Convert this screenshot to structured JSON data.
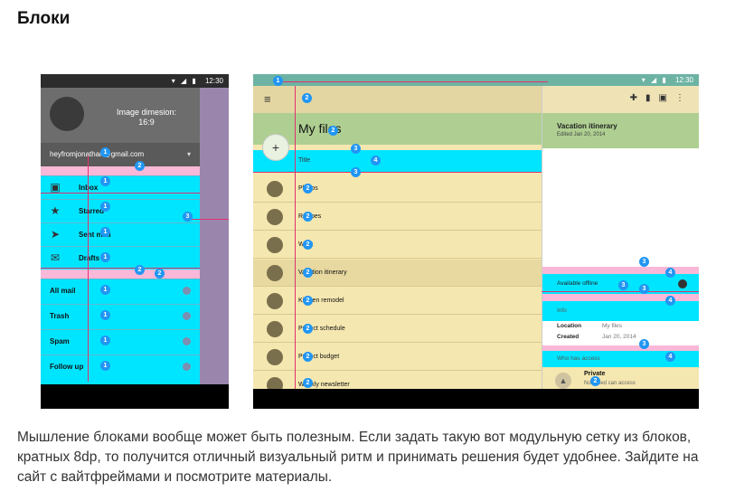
{
  "heading": "Блоки",
  "paragraph": "Мышление блоками вообще может быть полезным. Если задать такую вот модульную сетку из блоков, кратных 8dp, то получится отличный визуальный ритм и принимать решения будет удобнее. Зайдите на сайт с вайтфреймами и посмотрите материалы.",
  "phone": {
    "status_time": "12:30",
    "image_dimension_line1": "Image dimesion:",
    "image_dimension_line2": "16:9",
    "account_email": "heyfromjonathan@gmail.com",
    "items_primary": [
      {
        "label": "Inbox",
        "icon": "inbox-icon",
        "glyph": "▣"
      },
      {
        "label": "Starred",
        "icon": "star-icon",
        "glyph": "★"
      },
      {
        "label": "Sent mail",
        "icon": "send-icon",
        "glyph": "➤"
      },
      {
        "label": "Drafts",
        "icon": "drafts-icon",
        "glyph": "✉"
      }
    ],
    "items_secondary": [
      "All mail",
      "Trash",
      "Spam",
      "Follow up"
    ]
  },
  "tablet": {
    "status_time": "12:30",
    "app_title": "My files",
    "section_title": "Title",
    "files": [
      "Photos",
      "Recipes",
      "Work",
      "Vacation itinerary",
      "Kitchen remodel",
      "Project schedule",
      "Project budget",
      "Weekly newsletter"
    ],
    "detail": {
      "title": "Vacation itinerary",
      "subtitle": "Edited Jan 20, 2014",
      "available_offline": "Available offline",
      "info_label": "Info",
      "location_label": "Location",
      "location_value": "My files",
      "created_label": "Created",
      "created_value": "Jan 20, 2014",
      "who_has_access": "Who has access",
      "private_title": "Private",
      "private_subtitle": "Not listed can access"
    }
  },
  "colors": {
    "keyline_cyan": "#00e5ff",
    "margin_pink": "#f9b8d8",
    "marker_blue": "#2196f3",
    "appbar_green": "#aecf91"
  }
}
